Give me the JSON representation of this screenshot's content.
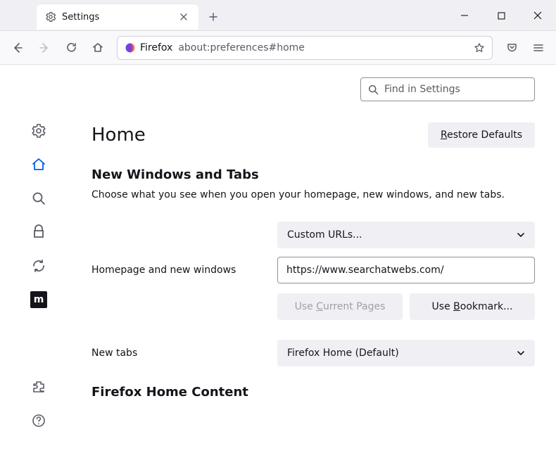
{
  "tab": {
    "title": "Settings"
  },
  "urlbar": {
    "identity": "Firefox",
    "url": "about:preferences#home"
  },
  "search": {
    "placeholder": "Find in Settings"
  },
  "header": {
    "title": "Home",
    "restore": "Restore Defaults",
    "restore_key": "R"
  },
  "section1": {
    "heading": "New Windows and Tabs",
    "desc": "Choose what you see when you open your homepage, new windows, and new tabs."
  },
  "homepage": {
    "label": "Homepage and new windows",
    "dropdown": "Custom URLs...",
    "value": "https://www.searchatwebs.com/",
    "use_current": "Use Current Pages",
    "use_current_key": "C",
    "use_bookmark": "Use Bookmark...",
    "use_bookmark_key": "B"
  },
  "newtabs": {
    "label": "New tabs",
    "dropdown": "Firefox Home (Default)"
  },
  "section2": {
    "heading": "Firefox Home Content"
  }
}
